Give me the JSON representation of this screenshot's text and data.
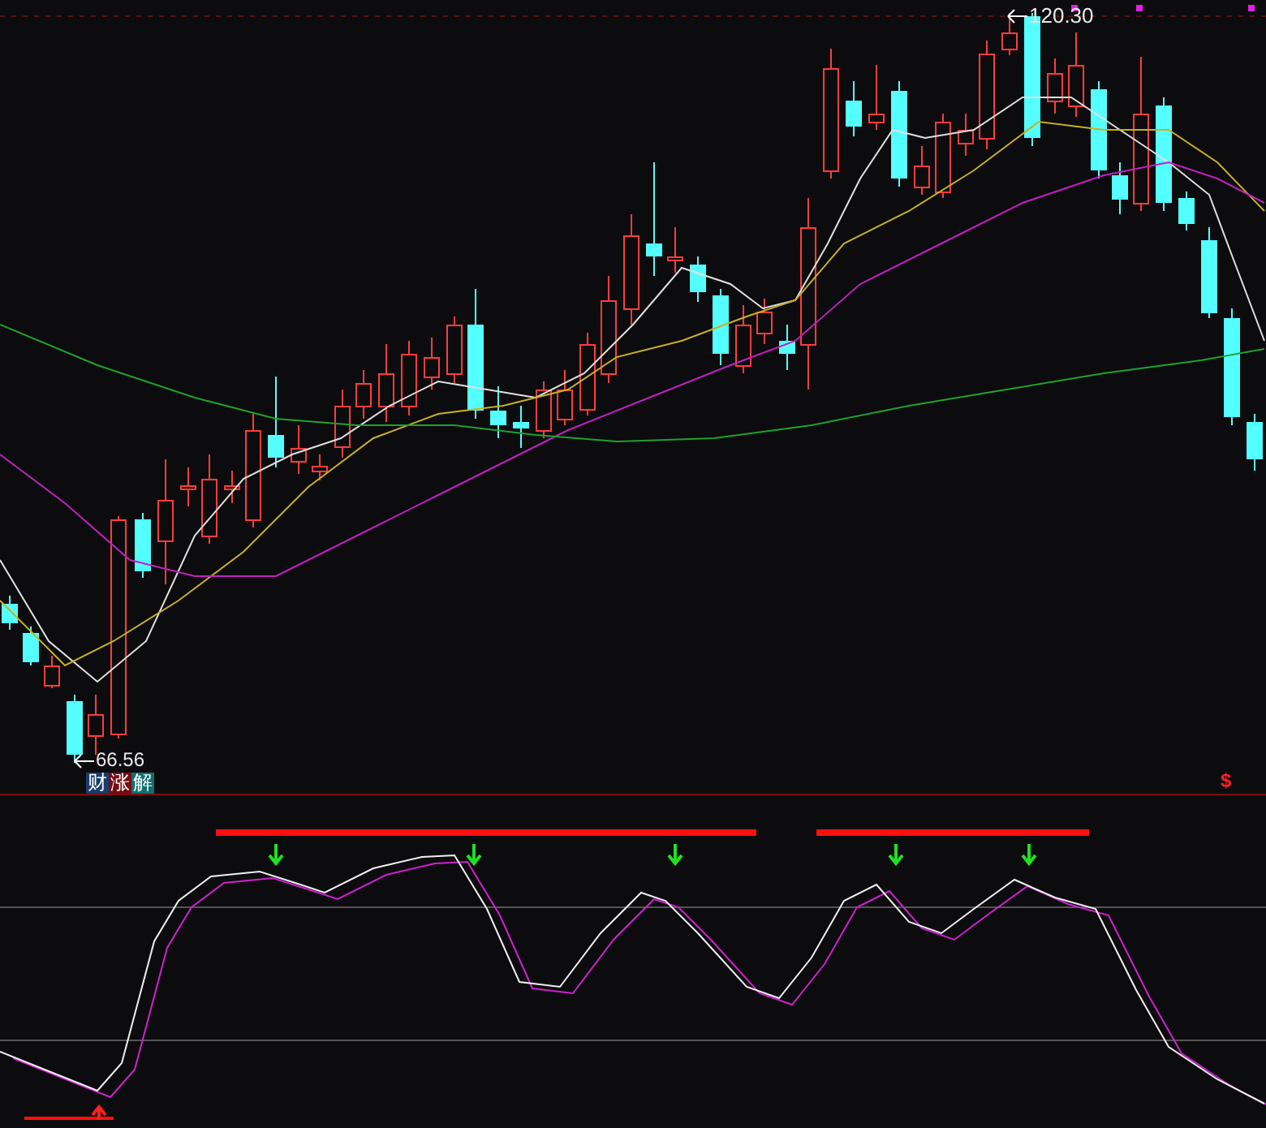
{
  "main_chart": {
    "high_label": "120.30",
    "low_label": "66.56",
    "corner_mark": "$",
    "buttons": [
      {
        "label": "财",
        "color": "#183c6c"
      },
      {
        "label": "涨",
        "color": "#780a12"
      },
      {
        "label": "解",
        "color": "#0e7070"
      }
    ]
  }
}
